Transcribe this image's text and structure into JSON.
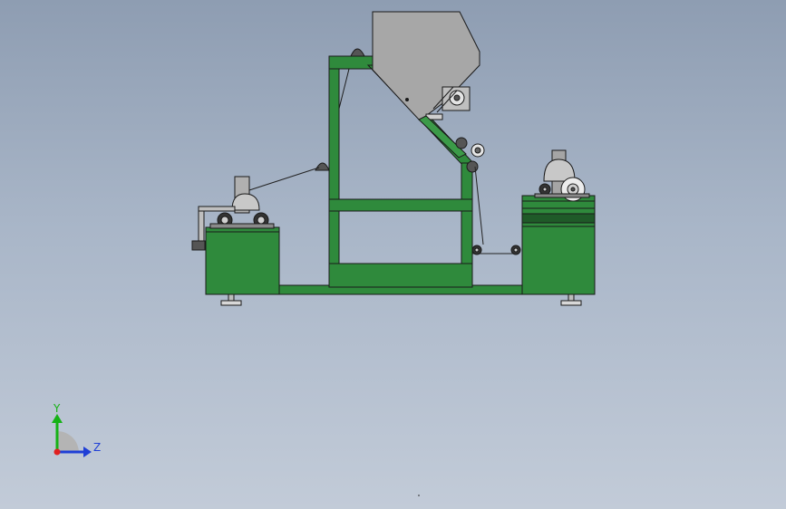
{
  "triad": {
    "y_label": "Y",
    "z_label": "Z",
    "colors": {
      "y_axis": "#16b216",
      "z_axis": "#1f3fd6",
      "x_axis": "#e02020"
    }
  },
  "colors": {
    "frame_green": "#2f8a3c",
    "hopper_gray": "#a7a7a7",
    "dark_gray": "#4a4a4a",
    "outline": "#1a1a1a"
  }
}
